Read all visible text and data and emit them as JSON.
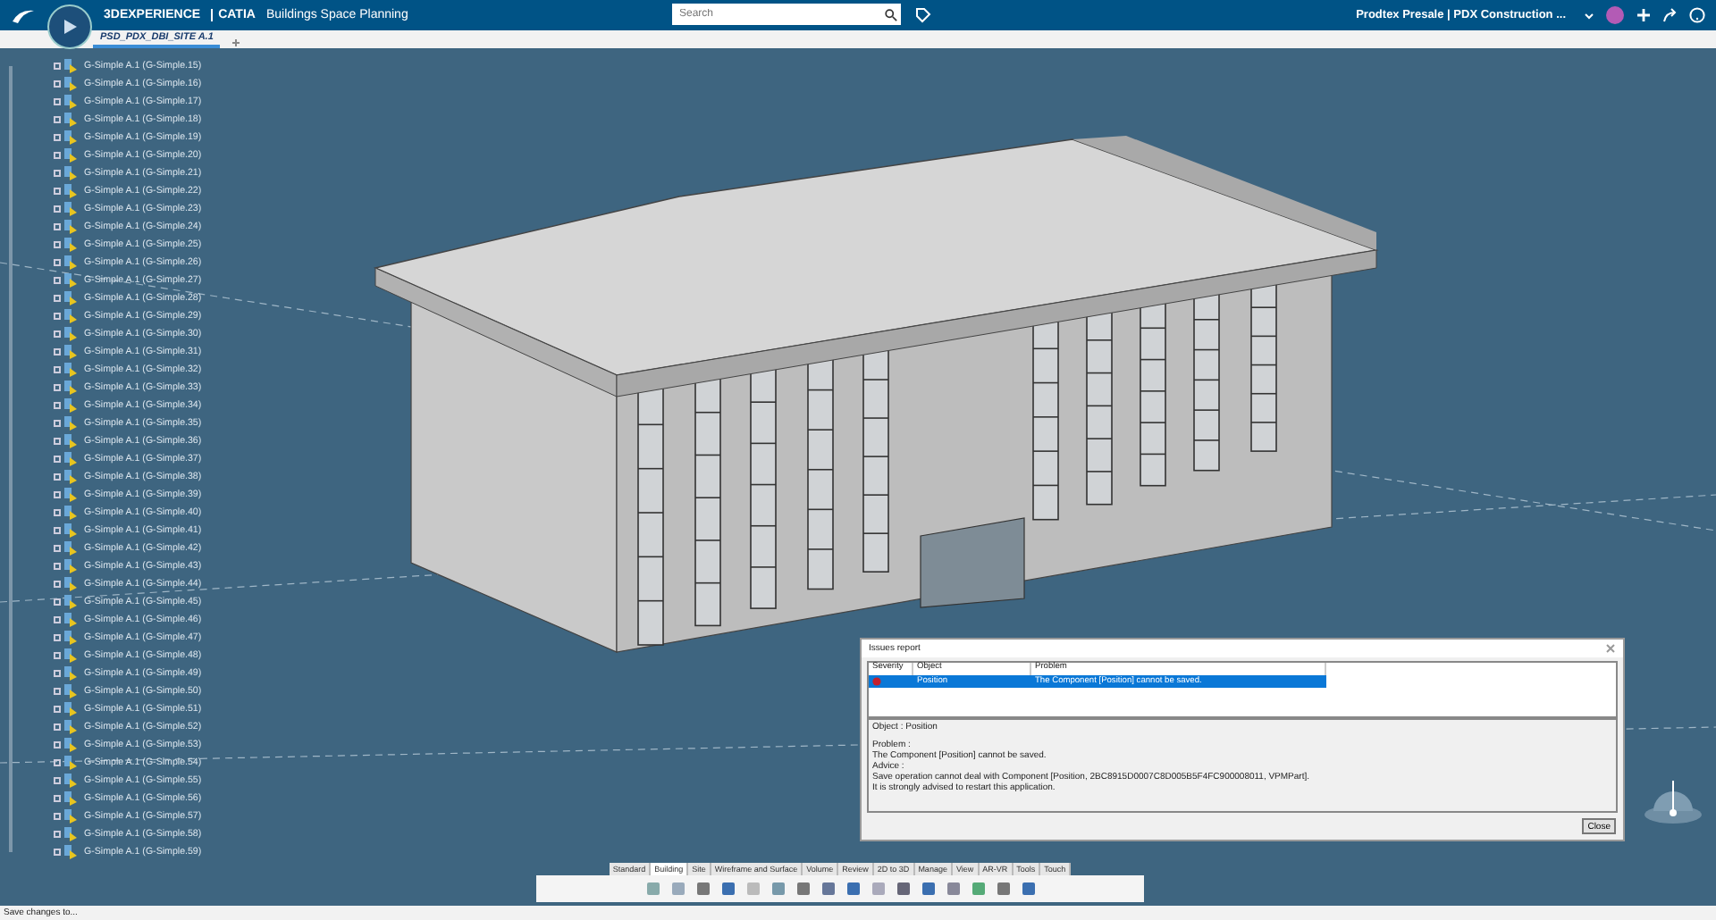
{
  "app": {
    "brand": "3DEXPERIENCE",
    "product": "CATIA",
    "role": "Buildings Space Planning"
  },
  "search": {
    "placeholder": "Search"
  },
  "user": {
    "label": "Prodtex Presale | PDX Construction ..."
  },
  "doc_tabs": [
    {
      "label": "PSD_PDX_DBI_SITE A.1",
      "selected": true
    }
  ],
  "tree": {
    "items": [
      "G-Simple A.1 (G-Simple.15)",
      "G-Simple A.1 (G-Simple.16)",
      "G-Simple A.1 (G-Simple.17)",
      "G-Simple A.1 (G-Simple.18)",
      "G-Simple A.1 (G-Simple.19)",
      "G-Simple A.1 (G-Simple.20)",
      "G-Simple A.1 (G-Simple.21)",
      "G-Simple A.1 (G-Simple.22)",
      "G-Simple A.1 (G-Simple.23)",
      "G-Simple A.1 (G-Simple.24)",
      "G-Simple A.1 (G-Simple.25)",
      "G-Simple A.1 (G-Simple.26)",
      "G-Simple A.1 (G-Simple.27)",
      "G-Simple A.1 (G-Simple.28)",
      "G-Simple A.1 (G-Simple.29)",
      "G-Simple A.1 (G-Simple.30)",
      "G-Simple A.1 (G-Simple.31)",
      "G-Simple A.1 (G-Simple.32)",
      "G-Simple A.1 (G-Simple.33)",
      "G-Simple A.1 (G-Simple.34)",
      "G-Simple A.1 (G-Simple.35)",
      "G-Simple A.1 (G-Simple.36)",
      "G-Simple A.1 (G-Simple.37)",
      "G-Simple A.1 (G-Simple.38)",
      "G-Simple A.1 (G-Simple.39)",
      "G-Simple A.1 (G-Simple.40)",
      "G-Simple A.1 (G-Simple.41)",
      "G-Simple A.1 (G-Simple.42)",
      "G-Simple A.1 (G-Simple.43)",
      "G-Simple A.1 (G-Simple.44)",
      "G-Simple A.1 (G-Simple.45)",
      "G-Simple A.1 (G-Simple.46)",
      "G-Simple A.1 (G-Simple.47)",
      "G-Simple A.1 (G-Simple.48)",
      "G-Simple A.1 (G-Simple.49)",
      "G-Simple A.1 (G-Simple.50)",
      "G-Simple A.1 (G-Simple.51)",
      "G-Simple A.1 (G-Simple.52)",
      "G-Simple A.1 (G-Simple.53)",
      "G-Simple A.1 (G-Simple.54)",
      "G-Simple A.1 (G-Simple.55)",
      "G-Simple A.1 (G-Simple.56)",
      "G-Simple A.1 (G-Simple.57)",
      "G-Simple A.1 (G-Simple.58)",
      "G-Simple A.1 (G-Simple.59)"
    ]
  },
  "dialog": {
    "title": "Issues report",
    "columns": [
      "Severity",
      "Object",
      "Problem"
    ],
    "rows": [
      {
        "kind": "error",
        "object": "Position",
        "problem": "The Component [Position] cannot be saved.",
        "selected": true
      }
    ],
    "heading": "Object : Position",
    "details": [
      "Problem :",
      "The Component [Position] cannot be saved.",
      "Advice :",
      "Save operation cannot deal with Component [Position, 2BC8915D0007C8D005B5F4FC900008011, VPMPart].",
      "It is strongly advised to restart this application."
    ],
    "button": "Close"
  },
  "toolbar_tabs": [
    {
      "label": "Standard",
      "selected": false
    },
    {
      "label": "Building",
      "selected": true
    },
    {
      "label": "Site",
      "selected": false
    },
    {
      "label": "Wireframe and Surface",
      "selected": false
    },
    {
      "label": "Volume",
      "selected": false
    },
    {
      "label": "Review",
      "selected": false
    },
    {
      "label": "2D to 3D",
      "selected": false
    },
    {
      "label": "Manage",
      "selected": false
    },
    {
      "label": "View",
      "selected": false
    },
    {
      "label": "AR-VR",
      "selected": false
    },
    {
      "label": "Tools",
      "selected": false
    },
    {
      "label": "Touch",
      "selected": false
    }
  ],
  "status_bar": {
    "text": "Save changes to..."
  }
}
